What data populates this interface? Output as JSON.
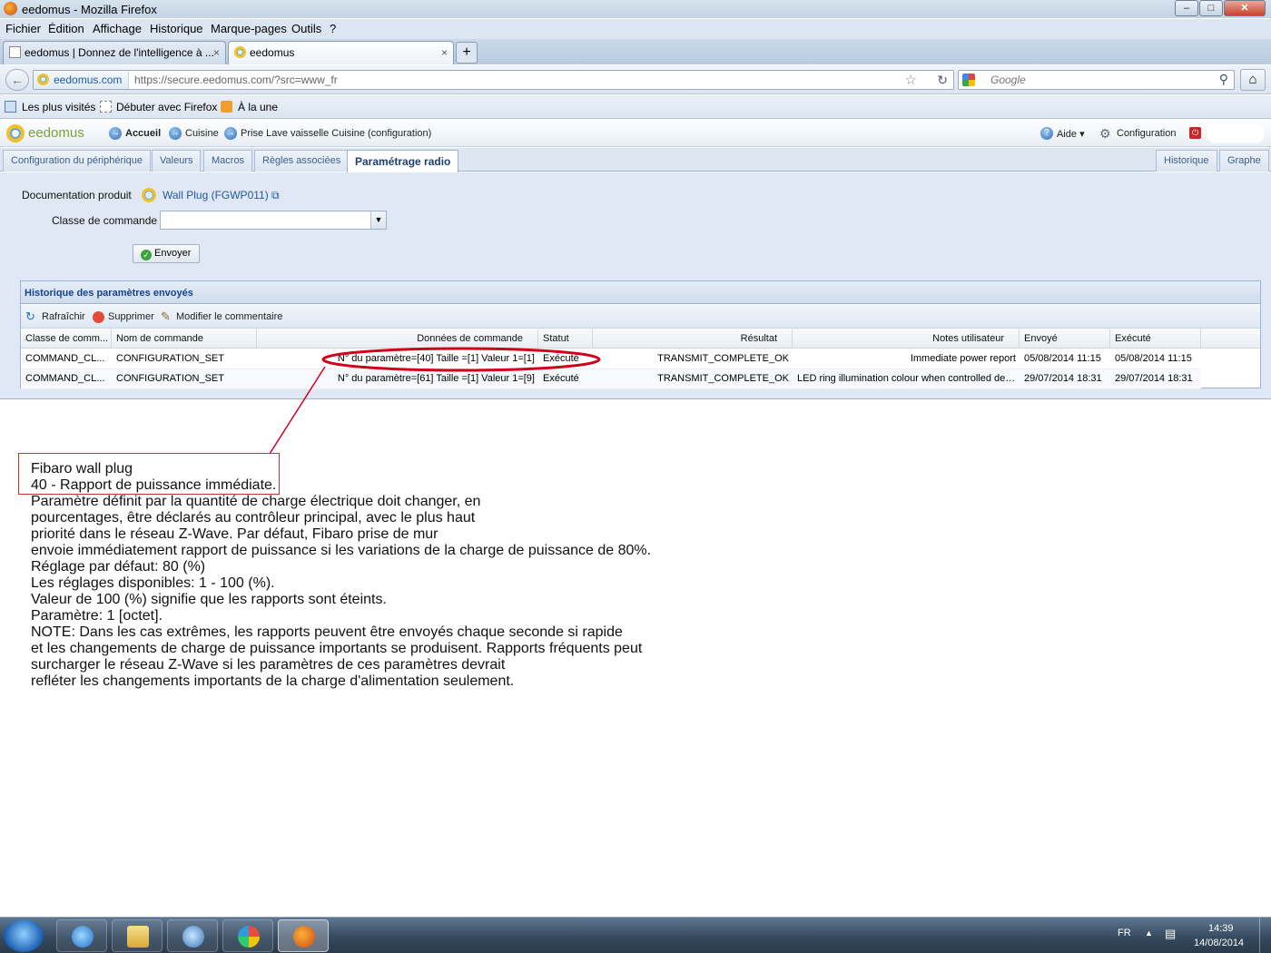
{
  "window": {
    "title": "eedomus - Mozilla Firefox",
    "min": "–",
    "max": "□",
    "close": "✕"
  },
  "menu": [
    "Fichier",
    "Édition",
    "Affichage",
    "Historique",
    "Marque-pages",
    "Outils",
    "?"
  ],
  "tabs": [
    {
      "label": "eedomus | Donnez de l'intelligence à ...",
      "close": "×"
    },
    {
      "label": "eedomus",
      "close": "×"
    }
  ],
  "new_tab": "+",
  "nav": {
    "site_identity": "eedomus.com",
    "url": "https://secure.eedomus.com/?src=www_fr",
    "search_placeholder": "Google"
  },
  "bookmarks": [
    "Les plus visités",
    "Débuter avec Firefox",
    "À la une"
  ],
  "app": {
    "logo": "eedomus",
    "breadcrumb": [
      "Accueil",
      "Cuisine",
      "Prise Lave vaisselle Cuisine (configuration)"
    ],
    "help": "Aide",
    "config": "Configuration"
  },
  "subtabs": [
    "Configuration du périphérique",
    "Valeurs",
    "Macros",
    "Règles associées",
    "Paramétrage radio"
  ],
  "subtabs_right": [
    "Historique",
    "Graphe"
  ],
  "form": {
    "doc_label": "Documentation produit",
    "doc_link": "Wall Plug (FGWP011)",
    "classe_label": "Classe de commande",
    "classe_value": "",
    "send_label": "Envoyer"
  },
  "history": {
    "title": "Historique des paramètres envoyés",
    "toolbar": [
      "Rafraîchir",
      "Supprimer",
      "Modifier le commentaire"
    ],
    "columns": [
      "Classe de comm...",
      "Nom de commande",
      "Données de commande",
      "Statut",
      "Résultat",
      "Notes utilisateur",
      "Envoyé",
      "Exécuté"
    ],
    "rows": [
      [
        "COMMAND_CL...",
        "CONFIGURATION_SET",
        "N° du paramètre=[40] Taille =[1] Valeur 1=[1]",
        "Exécuté",
        "TRANSMIT_COMPLETE_OK",
        "Immediate power report",
        "05/08/2014 11:15",
        "05/08/2014 11:15"
      ],
      [
        "COMMAND_CL...",
        "CONFIGURATION_SET",
        "N° du paramètre=[61] Taille =[1] Valeur 1=[9]",
        "Exécuté",
        "TRANSMIT_COMPLETE_OK",
        "LED ring illumination colour when controlled dev...",
        "29/07/2014 18:31",
        "29/07/2014 18:31"
      ]
    ]
  },
  "annotation": {
    "lines": [
      "Fibaro wall plug",
      "40 - Rapport de puissance immédiate.",
      "Paramètre définit par la quantité de charge électrique doit changer, en",
      "pourcentages, être déclarés au contrôleur principal, avec le plus haut",
      "priorité dans le réseau Z-Wave. Par défaut, Fibaro prise de mur",
      "envoie immédiatement rapport de puissance si les variations de la charge de puissance de 80%.",
      "Réglage par défaut: 80 (%)",
      "Les réglages disponibles: 1 - 100 (%).",
      "Valeur de 100 (%) signifie que les rapports sont éteints.",
      "Paramètre: 1 [octet].",
      "NOTE: Dans les cas extrêmes, les rapports peuvent être envoyés chaque seconde si rapide",
      "et les changements de charge de puissance importants se produisent. Rapports fréquents peut",
      "surcharger le réseau Z-Wave si les paramètres de ces paramètres devrait",
      "refléter les changements importants de la charge d'alimentation seulement."
    ],
    "color": "#d0021b"
  },
  "taskbar": {
    "lang": "FR",
    "time": "14:39",
    "date": "14/08/2014"
  }
}
